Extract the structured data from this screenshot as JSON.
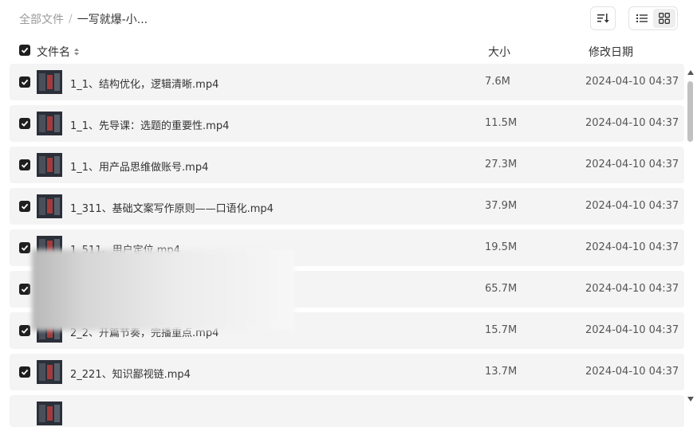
{
  "breadcrumb": {
    "root": "全部文件",
    "separator": "/",
    "current": "一写就爆-小..."
  },
  "toolbar": {
    "sort_icon": "sort-icon",
    "list_icon": "list-view-icon",
    "grid_icon": "grid-view-icon"
  },
  "header": {
    "name": "文件名",
    "size": "大小",
    "date": "修改日期"
  },
  "files": [
    {
      "name": "1_1、结构优化，逻辑清晰.mp4",
      "size": "7.6M",
      "date": "2024-04-10 04:37"
    },
    {
      "name": "1_1、先导课：选题的重要性.mp4",
      "size": "11.5M",
      "date": "2024-04-10 04:37"
    },
    {
      "name": "1_1、用产品思维做账号.mp4",
      "size": "27.3M",
      "date": "2024-04-10 04:37"
    },
    {
      "name": "1_311、基础文案写作原则——口语化.mp4",
      "size": "37.9M",
      "date": "2024-04-10 04:37"
    },
    {
      "name": "1_511、用户定位.mp4",
      "size": "19.5M",
      "date": "2024-04-10 04:37"
    },
    {
      "name": "",
      "size": "65.7M",
      "date": "2024-04-10 04:37"
    },
    {
      "name": "2_2、开篇节奏，完播重点.mp4",
      "size": "15.7M",
      "date": "2024-04-10 04:37"
    },
    {
      "name": "2_221、知识鄙视链.mp4",
      "size": "13.7M",
      "date": "2024-04-10 04:37"
    }
  ]
}
